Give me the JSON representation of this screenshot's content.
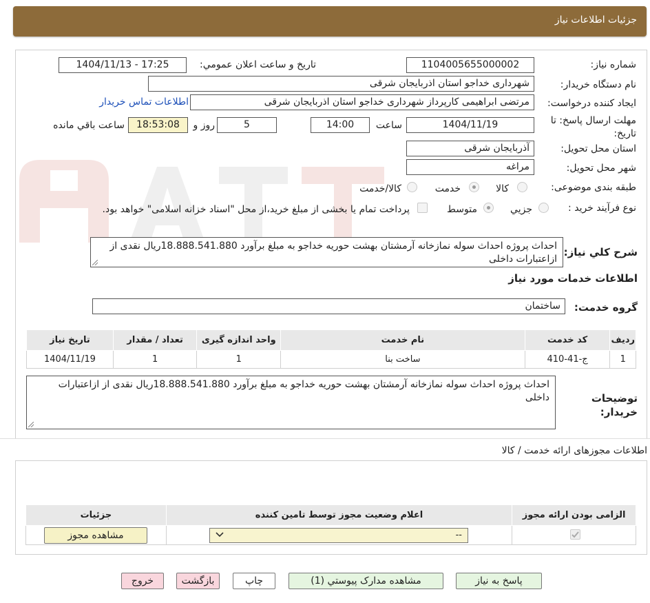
{
  "header": {
    "title": "جزئیات اطلاعات نیاز"
  },
  "form": {
    "need_number_label": "شماره نیاز:",
    "need_number": "1104005655000002",
    "announce_label": "تاریخ و ساعت اعلان عمومي:",
    "announce_value": "1404/11/13 - 17:25",
    "buyer_org_label": "نام دستگاه خريدار:",
    "buyer_org": "شهرداری خداجو استان اذربایجان شرقی",
    "creator_label": "ايجاد كننده درخواست:",
    "creator": "مرتضی ابراهیمی کارپرداز شهرداری خداجو استان اذربایجان شرقی",
    "contact_link": "اطلاعات تماس خریدار",
    "deadline_label": "مهلت ارسال پاسخ: تا تاريخ:",
    "deadline_date": "1404/11/19",
    "time_label": "ساعت",
    "deadline_time": "14:00",
    "days_value": "5",
    "days_label": "روز و",
    "remaining_time": "18:53:08",
    "remaining_label": "ساعت باقي مانده",
    "province_label": "استان محل تحويل:",
    "province": "آذربایجان شرقی",
    "city_label": "شهر محل تحويل:",
    "city": "مراغه",
    "category_label": "طبقه بندی موضوعی:",
    "category_options": [
      "کالا",
      "خدمت",
      "کالا/خدمت"
    ],
    "category_selected": "خدمت",
    "process_label": "نوع فرآيند خريد :",
    "process_options": [
      "جزيي",
      "متوسط"
    ],
    "process_selected": "متوسط",
    "treasury_note": "پرداخت تمام یا بخشی از مبلغ خرید،از محل \"اسناد خزانه اسلامی\" خواهد بود.",
    "general_desc_label": "شرح كلي نياز:",
    "general_desc": "احداث پروژه احداث سوله نمازخانه آرمشتان بهشت حوریه خداجو به مبلغ برآورد 18.888.541.880ریال نقدی از ازاعتبارات داخلی",
    "services_title": "اطلاعات خدمات مورد نياز",
    "service_group_label": "گروه خدمت:",
    "service_group": "ساختمان"
  },
  "services_table": {
    "headers": [
      "رديف",
      "کد خدمت",
      "نام خدمت",
      "واحد اندازه گيری",
      "تعداد / مقدار",
      "تاريخ نياز"
    ],
    "rows": [
      [
        "1",
        "ج-41-410",
        "ساخت بنا",
        "1",
        "1",
        "1404/11/19"
      ]
    ]
  },
  "buyer_notes_label": "توضيحات خريدار:",
  "buyer_notes": "احداث پروژه احداث سوله نمازخانه آرمشتان بهشت حوریه خداجو به مبلغ برآورد 18.888.541.880ریال نقدی از ازاعتبارات داخلی",
  "permits": {
    "title": "اطلاعات مجوزهای ارائه خدمت / کالا",
    "headers": [
      "الزامی بودن ارائه مجوز",
      "اعلام وضعيت مجوز توسط تامين کننده",
      "جزئيات"
    ],
    "select_value": "--",
    "view_button": "مشاهده مجوز"
  },
  "buttons": {
    "reply": "پاسخ به نياز",
    "attachments": "مشاهده مدارک پيوستي (1)",
    "print": "چاپ",
    "back": "بازگشت",
    "exit": "خروج"
  },
  "colors": {
    "header_bg": "#8d6b3a",
    "link": "#1c4fb8"
  }
}
